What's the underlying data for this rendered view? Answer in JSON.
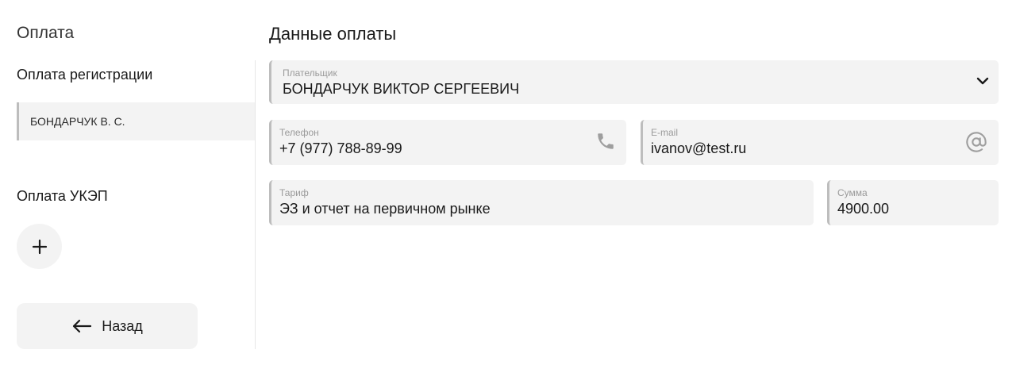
{
  "left": {
    "title": "Оплата",
    "registration_label": "Оплата регистрации",
    "payers": [
      "БОНДАРЧУК В. С."
    ],
    "ukep_label": "Оплата УКЭП",
    "add_icon": "plus-icon",
    "back_label": "Назад",
    "back_icon": "arrow-left-icon"
  },
  "main": {
    "title": "Данные оплаты",
    "payer": {
      "label": "Плательщик",
      "value": "БОНДАРЧУК ВИКТОР СЕРГЕЕВИЧ",
      "icon": "chevron-down-icon"
    },
    "phone": {
      "label": "Телефон",
      "value": "+7 (977) 788-89-99",
      "icon": "phone-icon"
    },
    "email": {
      "label": "E-mail",
      "value": "ivanov@test.ru",
      "icon": "at-sign-icon"
    },
    "tariff": {
      "label": "Тариф",
      "value": "ЭЗ и отчет на первичном рынке"
    },
    "sum": {
      "label": "Сумма",
      "value": "4900.00"
    }
  },
  "colors": {
    "field_background": "#f3f3f3",
    "field_accent_border": "#bdbdbd",
    "label_text": "#9a9a9a",
    "divider": "#e6e6e6"
  }
}
